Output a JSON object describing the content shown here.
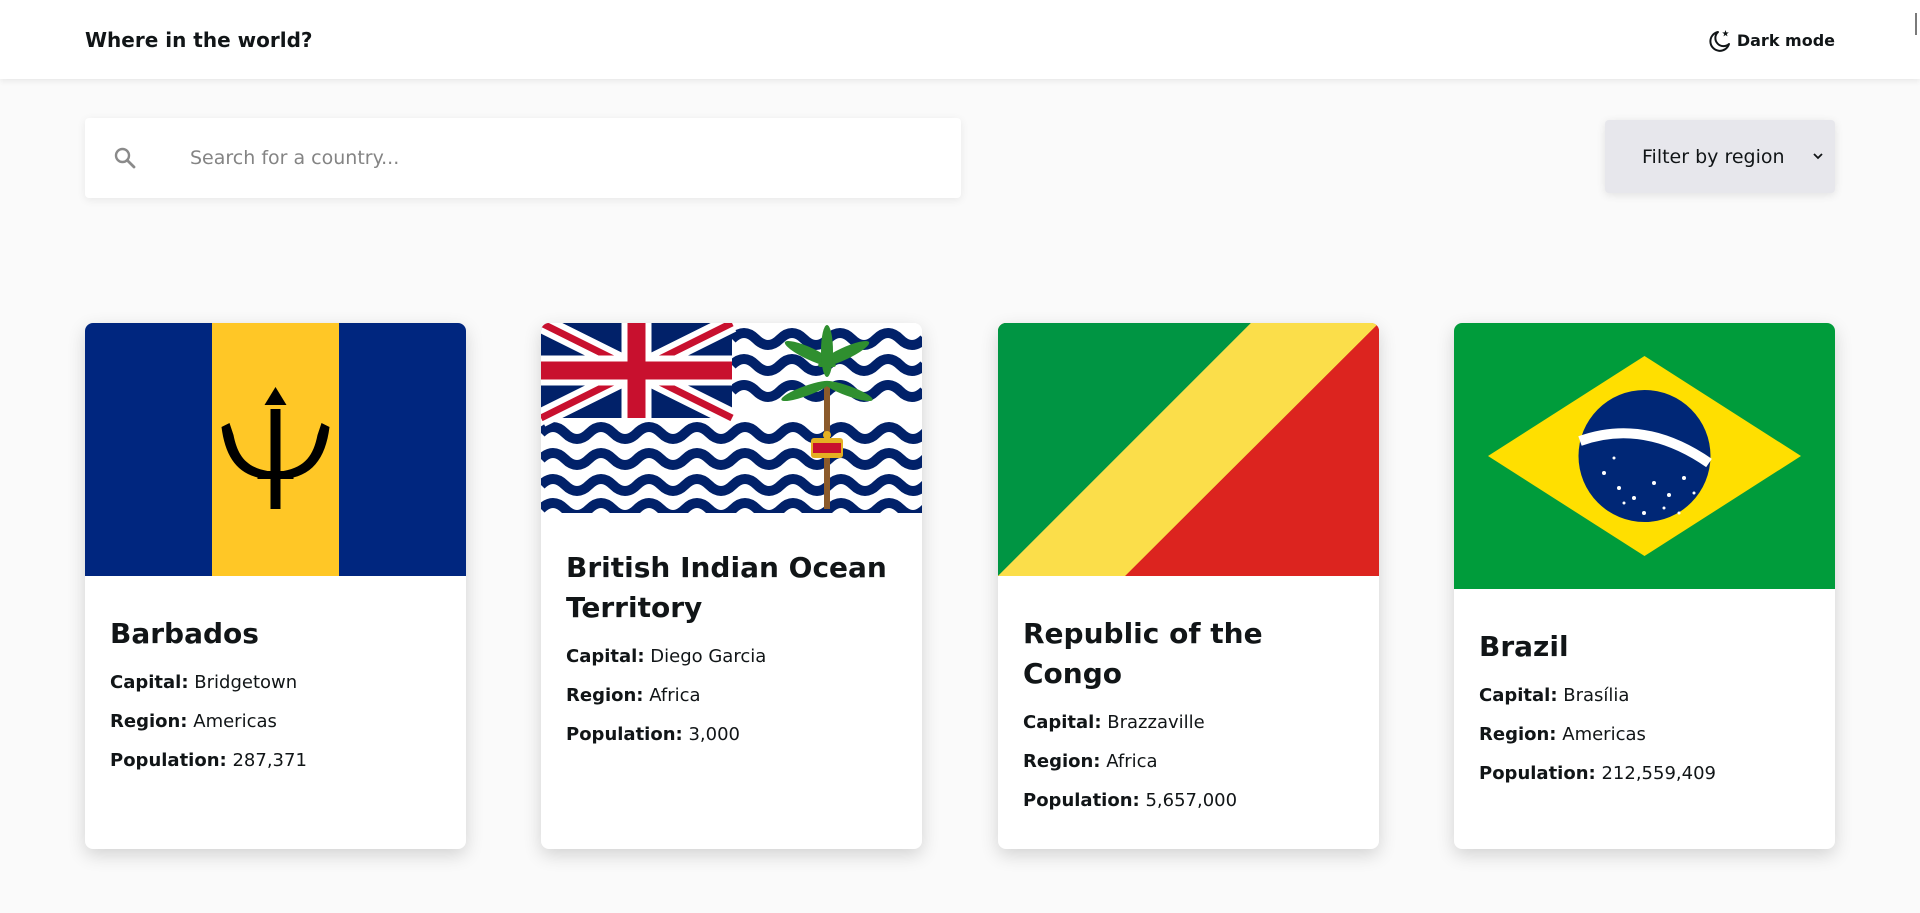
{
  "header": {
    "title": "Where in the world?",
    "theme_label": "Dark mode"
  },
  "search": {
    "placeholder": "Search for a country...",
    "value": ""
  },
  "filter": {
    "label": "Filter by region"
  },
  "detail_labels": {
    "capital": "Capital:",
    "region": "Region:",
    "population": "Population:"
  },
  "countries": [
    {
      "name": "Barbados",
      "capital": "Bridgetown",
      "region": "Americas",
      "population": "287,371",
      "flag": "barbados-flag"
    },
    {
      "name": "British Indian Ocean Territory",
      "capital": "Diego Garcia",
      "region": "Africa",
      "population": "3,000",
      "flag": "british-indian-ocean-territory-flag"
    },
    {
      "name": "Republic of the Congo",
      "capital": "Brazzaville",
      "region": "Africa",
      "population": "5,657,000",
      "flag": "republic-of-the-congo-flag"
    },
    {
      "name": "Brazil",
      "capital": "Brasília",
      "region": "Americas",
      "population": "212,559,409",
      "flag": "brazil-flag"
    }
  ],
  "colors": {
    "background": "#fafafa",
    "element": "#ffffff",
    "text": "#111517",
    "filter_background": "#e7e7ec"
  }
}
